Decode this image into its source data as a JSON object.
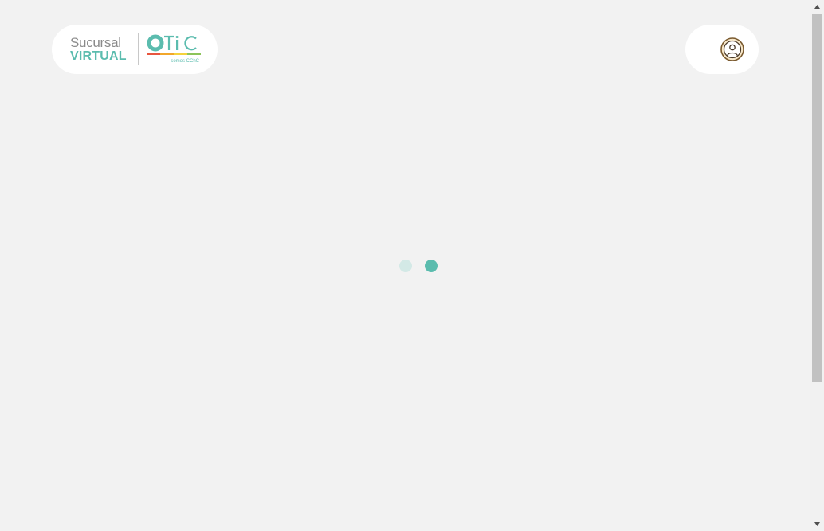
{
  "header": {
    "brand": {
      "line1": "Sucursal",
      "line2": "VIRTUAL",
      "partner_logo_text": "OTiC",
      "partner_tagline": "somos CChC"
    },
    "user_menu": {
      "icon": "user-circle-icon"
    }
  },
  "loader": {
    "state": "loading",
    "dots": 2
  },
  "colors": {
    "background": "#f2f2f2",
    "accent": "#5bbcae",
    "accent_light": "#d3e9e6",
    "brand_gray": "#8a8a8a",
    "user_icon": "#7a5a2f"
  }
}
